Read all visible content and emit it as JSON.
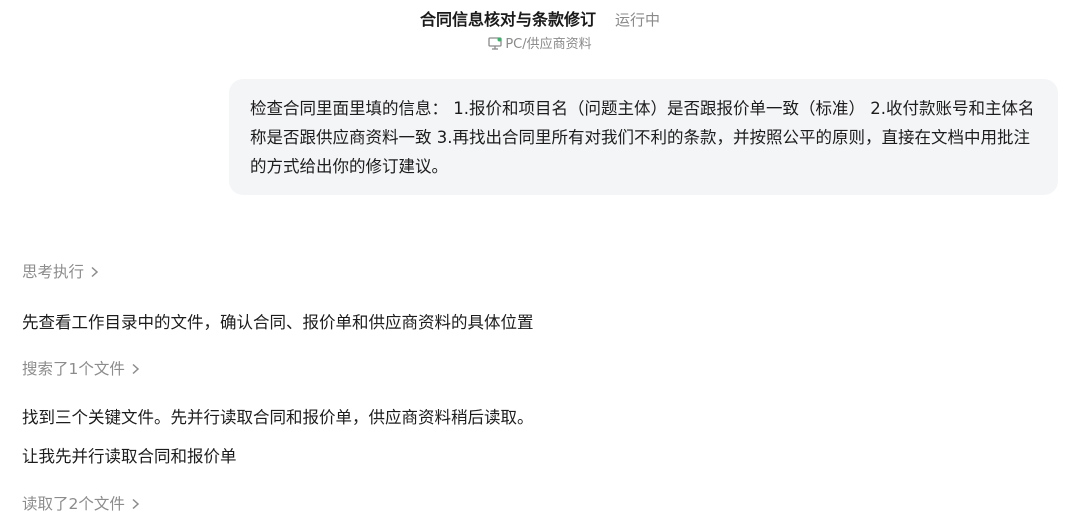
{
  "header": {
    "title": "合同信息核对与条款修订",
    "status": "运行中",
    "workspace": "PC/供应商资料",
    "workspace_icon": "monitor-icon"
  },
  "user_message": {
    "text": "检查合同里面里填的信息： 1.报价和项目名（问题主体）是否跟报价单一致（标准） 2.收付款账号和主体名称是否跟供应商资料一致 3.再找出合同里所有对我们不利的条款，并按照公平的原则，直接在文档中用批注的方式给出你的修订建议。"
  },
  "assistant": {
    "thinking_label": "思考执行",
    "message_1": "先查看工作目录中的文件，确认合同、报价单和供应商资料的具体位置",
    "search_step_label": "搜索了1个文件",
    "message_2": "找到三个关键文件。先并行读取合同和报价单，供应商资料稍后读取。",
    "message_3": "让我先并行读取合同和报价单",
    "read_step_label": "读取了2个文件"
  },
  "colors": {
    "bubble_bg": "#f4f5f7",
    "muted_text": "#8c8c8c",
    "body_text": "#1c1c1c"
  }
}
